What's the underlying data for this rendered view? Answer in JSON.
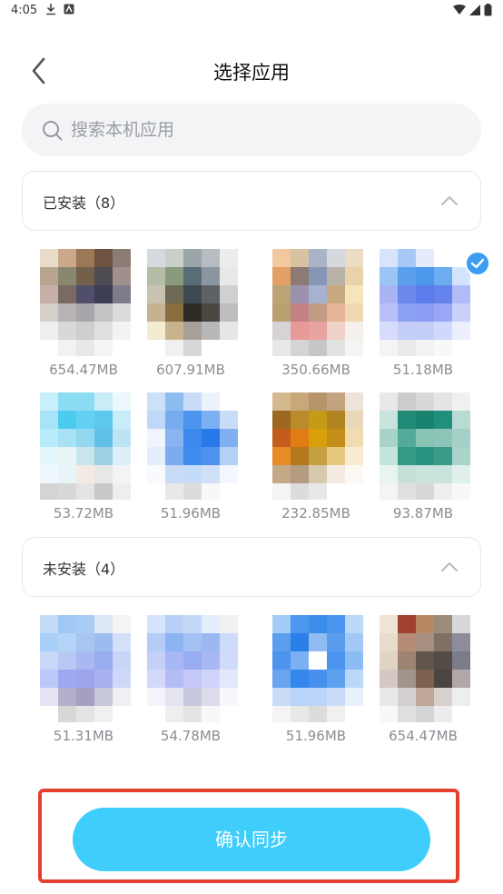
{
  "status_bar": {
    "time": "4:05"
  },
  "header": {
    "title": "选择应用"
  },
  "search": {
    "placeholder": "搜索本机应用"
  },
  "sections": {
    "installed": {
      "title": "已安装（8）",
      "apps": [
        {
          "size": "654.47MB",
          "selected": false,
          "palette": [
            "#e8dcc8",
            "#c9a98a",
            "#9b7856",
            "#6e5440",
            "#8b7d76",
            "#b9a48f",
            "#8a8770",
            "#74604a",
            "#4e4b52",
            "#a08f8a",
            "#c6b0a8",
            "#7a6a64",
            "#504e6a",
            "#3d3d54",
            "#7e7c8a",
            "#d4cfc9",
            "#b9b3b3",
            "#a8a6ab",
            "#c4c3c6",
            "#dddcdc",
            "#eeeeee",
            "#d8d8d8",
            "#cfcfcf",
            "#e0e0e0",
            "#f3f3f3",
            "#ffffff",
            "#f2f2f2",
            "#e8e8e8",
            "#f5f5f5",
            "#ffffff"
          ]
        },
        {
          "size": "607.91MB",
          "selected": false,
          "palette": [
            "#d6dae0",
            "#c8d0c8",
            "#9aa6a8",
            "#b5bcc2",
            "#eceded",
            "#b4bca6",
            "#8a9a7e",
            "#5a6c76",
            "#8b96a0",
            "#e8e8e8",
            "#c8c2b0",
            "#6e6a54",
            "#3e4a52",
            "#5e6264",
            "#d0d0d0",
            "#c4b290",
            "#8a6e3e",
            "#2e2a24",
            "#4a4640",
            "#bdbdbd",
            "#f4ecd0",
            "#c8b48c",
            "#a8a098",
            "#b8b8b8",
            "#e6e6e6",
            "#ffffff",
            "#f0f0f0",
            "#d8d8d8",
            "#ffffff",
            "#ffffff"
          ]
        },
        {
          "size": "350.66MB",
          "selected": false,
          "palette": [
            "#f2c89e",
            "#d8c2a2",
            "#a9b4c8",
            "#d6d8de",
            "#ecdcc4",
            "#e2a066",
            "#8c7a74",
            "#8696b4",
            "#b8b2a8",
            "#e8d2a8",
            "#bca476",
            "#9c92b0",
            "#a8b2d0",
            "#c8a880",
            "#f4e6b8",
            "#b8a070",
            "#c48284",
            "#c49c84",
            "#e6b496",
            "#f0d8b0",
            "#d6d2d6",
            "#e89a98",
            "#e8a2a0",
            "#f0d2c8",
            "#f4f0ec",
            "#e8e8ea",
            "#d4d4d6",
            "#c6c6c8",
            "#e2e2e2",
            "#f4f4f4"
          ]
        },
        {
          "size": "51.18MB",
          "selected": true,
          "palette": [
            "#d8e4fc",
            "#a8c8f8",
            "#e4ecfc",
            "#ffffff",
            "#ffffff",
            "#9cc4f4",
            "#5aa0ec",
            "#4c98ec",
            "#6cacf0",
            "#d4e4fc",
            "#a8b4f4",
            "#6c88ec",
            "#5c7cec",
            "#6484ec",
            "#b0bcf8",
            "#b8c0f8",
            "#8ca0f4",
            "#8c9cf4",
            "#98a8f4",
            "#c8d0fc",
            "#d8dcfc",
            "#c4ccf8",
            "#c4ccf8",
            "#d0d8fc",
            "#eceefe",
            "#f4f4f4",
            "#eaeaea",
            "#f2f2f2",
            "#f8f8f8",
            "#ffffff"
          ]
        },
        {
          "size": "53.72MB",
          "selected": false,
          "palette": [
            "#c8f0fc",
            "#8cdcf4",
            "#8cdcf4",
            "#c8ecf8",
            "#ecf8fc",
            "#a8e4f8",
            "#4ccaf0",
            "#64d0f2",
            "#5cc8ee",
            "#c8ecf8",
            "#b8ecfa",
            "#a8e0f4",
            "#94d8f0",
            "#60c0ea",
            "#bce4f4",
            "#e4f6fc",
            "#e8f4f6",
            "#c8e4ec",
            "#9cd0e4",
            "#dcf0f8",
            "#eef8fc",
            "#e8f4f8",
            "#f4eae4",
            "#e8e8e8",
            "#f4f4f4",
            "#d4d4d4",
            "#d8d8d8",
            "#e4e4e4",
            "#c8c8c8",
            "#eeeeee"
          ]
        },
        {
          "size": "51.96MB",
          "selected": false,
          "palette": [
            "#cce0f8",
            "#8cbcf0",
            "#c8dcf8",
            "#ecf2fc",
            "#ffffff",
            "#c0d8f8",
            "#78acf0",
            "#4c94ee",
            "#7cb0f2",
            "#c8dcf8",
            "#f0f4fc",
            "#88b4f2",
            "#3c88ec",
            "#2878e8",
            "#80b0f2",
            "#e4eefc",
            "#7cacf0",
            "#408cec",
            "#4c92ee",
            "#b4d0f6",
            "#f8fafe",
            "#c8dcf8",
            "#c4dcf8",
            "#d0e0f8",
            "#f4f8fe",
            "#ffffff",
            "#e8e8e8",
            "#dcdcdc",
            "#f8f8f8",
            "#ffffff"
          ]
        },
        {
          "size": "232.85MB",
          "selected": false,
          "palette": [
            "#d4b890",
            "#c8a878",
            "#b8946c",
            "#c4a480",
            "#ece4d8",
            "#9c6820",
            "#b88c2c",
            "#c49a18",
            "#b08420",
            "#e8d8b8",
            "#c45c1c",
            "#e07c14",
            "#d8a008",
            "#c48c18",
            "#f0dcb0",
            "#e88c28",
            "#b4781c",
            "#c4a040",
            "#e8c880",
            "#f8ecd4",
            "#c4a888",
            "#b49c80",
            "#d8c8b0",
            "#f4ece0",
            "#fcf8f4",
            "#f4f4f4",
            "#dcdcdc",
            "#e8e8e8",
            "#ffffff",
            "#ffffff"
          ]
        },
        {
          "size": "93.87MB",
          "selected": false,
          "palette": [
            "#e8e8e8",
            "#cccccc",
            "#d8d8d8",
            "#e4e4e4",
            "#f0f0f0",
            "#c8e4dc",
            "#208c78",
            "#188470",
            "#20907c",
            "#b8dcd4",
            "#a8d4c8",
            "#54aa98",
            "#88c4b4",
            "#8cc4b8",
            "#a4d0c8",
            "#c4e4dc",
            "#349a86",
            "#2a9280",
            "#3a9c88",
            "#a8d4ca",
            "#e8f4f0",
            "#c4e0d8",
            "#c8e4dc",
            "#c8e4dc",
            "#e0f0ec",
            "#f4f4f4",
            "#e0e0e0",
            "#d8d8d8",
            "#eeeeee",
            "#f8f8f8"
          ]
        }
      ]
    },
    "not_installed": {
      "title": "未安装（4）",
      "apps": [
        {
          "size": "51.31MB",
          "selected": false,
          "palette": [
            "#c4dcf8",
            "#a0c8f4",
            "#a8ccf4",
            "#dce8f8",
            "#f4f4f4",
            "#a8d0f8",
            "#b4d4f8",
            "#a8c4f0",
            "#9cbcf0",
            "#d4e0fa",
            "#c8d8f8",
            "#b8c8f4",
            "#a8b8f0",
            "#98acf0",
            "#c8d4f8",
            "#bcc8f8",
            "#9ca8f0",
            "#9ca4ec",
            "#a8b0f0",
            "#d0d8fa",
            "#e4e4f4",
            "#b4b0cc",
            "#a4a0c0",
            "#c8c8dc",
            "#f0f0f4",
            "#ffffff",
            "#d8d8d8",
            "#e4e4e4",
            "#f0f0f0",
            "#ffffff"
          ]
        },
        {
          "size": "54.78MB",
          "selected": false,
          "palette": [
            "#d4e4fa",
            "#b8d0f6",
            "#c4d8f8",
            "#e4eefc",
            "#f0f0f0",
            "#b4ccf6",
            "#8cb4f2",
            "#a4c0f4",
            "#9cb8f2",
            "#cedcfa",
            "#c4d0f8",
            "#a8b8f4",
            "#98acf0",
            "#a8b8f2",
            "#d0dafa",
            "#d4d8fa",
            "#b4bcf4",
            "#c4c8f8",
            "#d0d4fa",
            "#e4e8fc",
            "#f4f4fc",
            "#e4e4f0",
            "#c8c8dc",
            "#dcdcea",
            "#f8f8fc",
            "#ffffff",
            "#eeeeee",
            "#e4e4e4",
            "#f8f8f8",
            "#ffffff"
          ]
        },
        {
          "size": "51.96MB",
          "selected": false,
          "palette": [
            "#a4ccf8",
            "#4c98ee",
            "#3c8cec",
            "#4894ee",
            "#bcd8f8",
            "#5c9eee",
            "#2a80e8",
            "#90bcf2",
            "#5c9cee",
            "#a4c8f6",
            "#4c94ee",
            "#7cb0f2",
            "#ffffff",
            "#4c94ee",
            "#8cbcf4",
            "#68a4f0",
            "#3488ec",
            "#4890ee",
            "#5ca0f0",
            "#bcd8f8",
            "#c8dcf8",
            "#b8d4f8",
            "#bcd4f8",
            "#c8dcf8",
            "#e8f0fc",
            "#f4f4f4",
            "#e8e8e8",
            "#dcdcdc",
            "#f0f0f0",
            "#ffffff"
          ]
        },
        {
          "size": "654.47MB",
          "selected": false,
          "palette": [
            "#f0e4d4",
            "#a04030",
            "#b88860",
            "#9c8c7c",
            "#d8d8d8",
            "#e8dccc",
            "#b48c78",
            "#a89080",
            "#807064",
            "#8c8c9c",
            "#e0d4c4",
            "#9c8470",
            "#60564c",
            "#544a48",
            "#7c7c88",
            "#d4c8c4",
            "#a0948c",
            "#7c6050",
            "#4c4440",
            "#b0a8a8",
            "#e8e8e8",
            "#d4d0d0",
            "#c0a898",
            "#d8d0cc",
            "#eeeeee",
            "#f8f8f8",
            "#e0e0e0",
            "#d4d4d4",
            "#ececec",
            "#ffffff"
          ]
        }
      ]
    }
  },
  "confirm": {
    "label": "确认同步"
  },
  "colors": {
    "accent": "#3fcdfb",
    "highlight": "#e5402f",
    "check": "#3b9cf2"
  }
}
